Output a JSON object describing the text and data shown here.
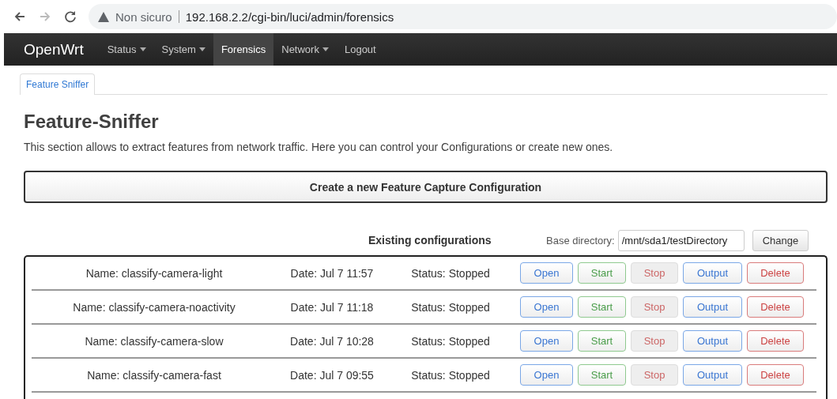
{
  "browser": {
    "security": "Non sicuro",
    "url": "192.168.2.2/cgi-bin/luci/admin/forensics"
  },
  "navbar": {
    "brand": "OpenWrt",
    "items": [
      {
        "label": "Status",
        "dropdown": true,
        "selected": false
      },
      {
        "label": "System",
        "dropdown": true,
        "selected": false
      },
      {
        "label": "Forensics",
        "dropdown": false,
        "selected": true
      },
      {
        "label": "Network",
        "dropdown": true,
        "selected": false
      },
      {
        "label": "Logout",
        "dropdown": false,
        "selected": false
      }
    ]
  },
  "tabs": [
    {
      "label": "Feature Sniffer",
      "selected": true
    }
  ],
  "heading": "Feature-Sniffer",
  "description": "This section allows to extract features from network traffic. Here you can control your Configurations or create new ones.",
  "create_button": "Create a new Feature Capture Configuration",
  "existing_title": "Existing configurations",
  "base_directory": {
    "label": "Base directory:",
    "value": "/mnt/sda1/testDirectory",
    "button": "Change"
  },
  "configurations": [
    {
      "name": "Name: classify-camera-light",
      "date": "Date: Jul 7 11:57",
      "status": "Status: Stopped",
      "buttons": [
        {
          "label": "Open",
          "kind": "action",
          "disabled": false
        },
        {
          "label": "Start",
          "kind": "apply",
          "disabled": false
        },
        {
          "label": "Stop",
          "kind": "remove",
          "disabled": true
        },
        {
          "label": "Output",
          "kind": "action",
          "disabled": false
        },
        {
          "label": "Delete",
          "kind": "remove",
          "disabled": false
        }
      ]
    },
    {
      "name": "Name: classify-camera-noactivity",
      "date": "Date: Jul 7 11:18",
      "status": "Status: Stopped",
      "buttons": [
        {
          "label": "Open",
          "kind": "action",
          "disabled": false
        },
        {
          "label": "Start",
          "kind": "apply",
          "disabled": false
        },
        {
          "label": "Stop",
          "kind": "remove",
          "disabled": true
        },
        {
          "label": "Output",
          "kind": "action",
          "disabled": false
        },
        {
          "label": "Delete",
          "kind": "remove",
          "disabled": false
        }
      ]
    },
    {
      "name": "Name: classify-camera-slow",
      "date": "Date: Jul 7 10:28",
      "status": "Status: Stopped",
      "buttons": [
        {
          "label": "Open",
          "kind": "action",
          "disabled": false
        },
        {
          "label": "Start",
          "kind": "apply",
          "disabled": false
        },
        {
          "label": "Stop",
          "kind": "remove",
          "disabled": true
        },
        {
          "label": "Output",
          "kind": "action",
          "disabled": false
        },
        {
          "label": "Delete",
          "kind": "remove",
          "disabled": false
        }
      ]
    },
    {
      "name": "Name: classify-camera-fast",
      "date": "Date: Jul 7 09:55",
      "status": "Status: Stopped",
      "buttons": [
        {
          "label": "Open",
          "kind": "action",
          "disabled": false
        },
        {
          "label": "Start",
          "kind": "apply",
          "disabled": false
        },
        {
          "label": "Stop",
          "kind": "remove",
          "disabled": true
        },
        {
          "label": "Output",
          "kind": "action",
          "disabled": false
        },
        {
          "label": "Delete",
          "kind": "remove",
          "disabled": false
        }
      ]
    }
  ]
}
